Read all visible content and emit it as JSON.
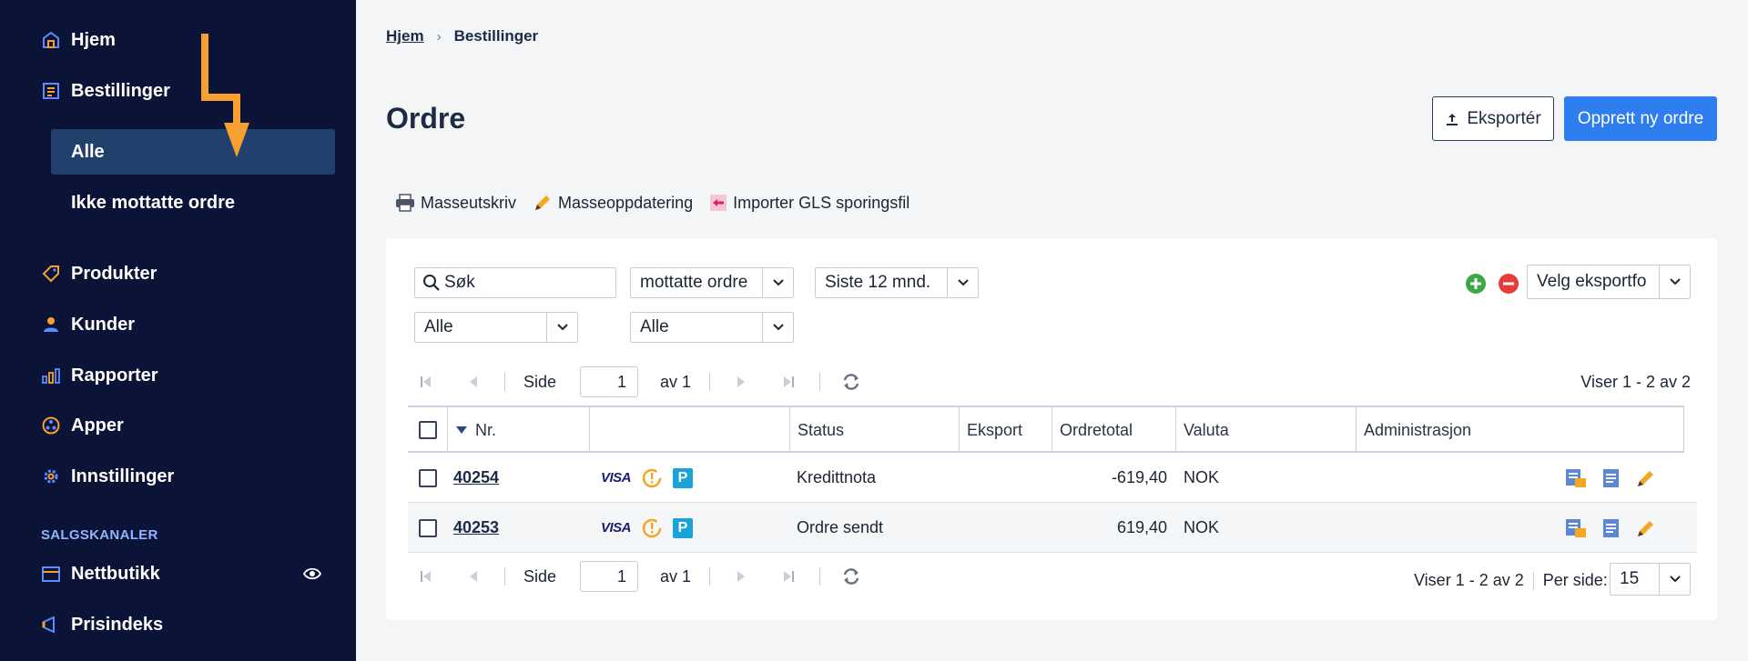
{
  "sidebar": {
    "items": [
      {
        "label": "Hjem",
        "icon": "home-icon"
      },
      {
        "label": "Bestillinger",
        "icon": "orders-list-icon"
      },
      {
        "label": "Produkter",
        "icon": "tag-icon"
      },
      {
        "label": "Kunder",
        "icon": "user-icon"
      },
      {
        "label": "Rapporter",
        "icon": "bar-chart-icon"
      },
      {
        "label": "Apper",
        "icon": "apps-icon"
      },
      {
        "label": "Innstillinger",
        "icon": "gear-icon"
      }
    ],
    "subitems": [
      {
        "label": "Alle",
        "active": true
      },
      {
        "label": "Ikke mottatte ordre",
        "active": false
      }
    ],
    "section_label": "SALGSKANALER",
    "channels": [
      {
        "label": "Nettbutikk",
        "icon": "store-icon"
      },
      {
        "label": "Prisindeks",
        "icon": "megaphone-icon"
      }
    ]
  },
  "breadcrumb": {
    "home": "Hjem",
    "current": "Bestillinger"
  },
  "page_title": "Ordre",
  "actions": {
    "export_label": "Eksportér",
    "create_label": "Opprett ny ordre"
  },
  "toolbar": {
    "mass_print": "Masseutskriv",
    "mass_update": "Masseoppdatering",
    "import_gls": "Importer GLS sporingsfil"
  },
  "filters": {
    "search_value": "Søk",
    "status_filter": "mottatte ordre",
    "period_filter": "Siste 12 mnd.",
    "filter_a": "Alle",
    "filter_b": "Alle",
    "export_format": "Velg eksportfo"
  },
  "pager": {
    "side_label": "Side",
    "page": "1",
    "of_label": "av 1",
    "showing": "Viser 1 - 2 av 2",
    "per_page_label": "Per side:",
    "per_page": "15"
  },
  "table": {
    "columns": [
      "Nr.",
      "",
      "Status",
      "Eksport",
      "Ordretotal",
      "Valuta",
      "Administrasjon"
    ],
    "rows": [
      {
        "nr": "40254",
        "status": "Kredittnota",
        "eksport": "",
        "total": "-619,40",
        "valuta": "NOK"
      },
      {
        "nr": "40253",
        "status": "Ordre sendt",
        "eksport": "",
        "total": "619,40",
        "valuta": "NOK"
      }
    ],
    "payment_card": "VISA",
    "payment_p": "P"
  },
  "colors": {
    "sidebar_bg": "#0b1437",
    "active_bg": "#21406c",
    "accent_blue": "#2f7ef0",
    "annotation_orange": "#f5a030"
  }
}
